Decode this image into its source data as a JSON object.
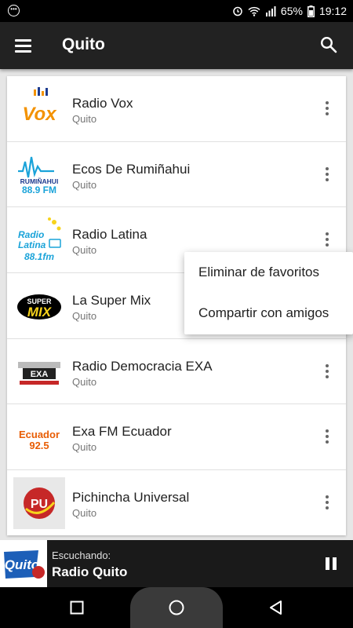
{
  "status_bar": {
    "time": "19:12",
    "battery": "65%",
    "icons": [
      "notification-icon",
      "alarm-icon",
      "wifi-icon",
      "signal-icon",
      "battery-icon"
    ]
  },
  "app_bar": {
    "title": "Quito",
    "menu_icon": "hamburger-menu-icon",
    "search_icon": "search-icon"
  },
  "stations": [
    {
      "name": "Radio Vox",
      "city": "Quito",
      "logo_text": "Vox"
    },
    {
      "name": "Ecos De Rumiñahui",
      "city": "Quito",
      "logo_text": "RUMIÑAHUI 88.9 FM"
    },
    {
      "name": "Radio Latina",
      "city": "Quito",
      "logo_text": "Radio Latina 88.1fm"
    },
    {
      "name": "La Super Mix",
      "city": "Quito",
      "logo_text": "SUPER MIX"
    },
    {
      "name": "Radio Democracia EXA",
      "city": "Quito",
      "logo_text": "EXA"
    },
    {
      "name": "Exa FM Ecuador",
      "city": "Quito",
      "logo_text": "Ecuador 92.5"
    },
    {
      "name": "Pichincha Universal",
      "city": "Quito",
      "logo_text": "PU"
    }
  ],
  "context_menu": {
    "items": [
      "Eliminar de favoritos",
      "Compartir con amigos"
    ]
  },
  "now_playing": {
    "label": "Escuchando:",
    "station": "Radio Quito",
    "logo_text": "Quito"
  },
  "colors": {
    "app_bar": "#222222",
    "player": "#1a1a1a",
    "vox_orange": "#f39200",
    "vox_blue": "#1d3b8f",
    "latina_blue": "#1aa3d9",
    "supermix_yellow": "#f7d31b",
    "exa_orange": "#e85d04",
    "pu_red": "#c62828"
  }
}
